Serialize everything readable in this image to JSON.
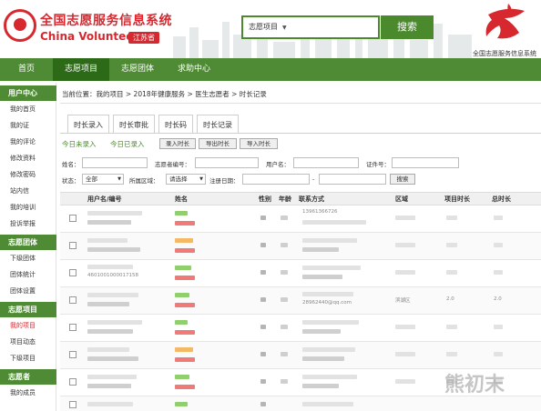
{
  "header": {
    "site_title": "全国志愿服务信息系统",
    "site_subtitle": "China Volunteer",
    "province": "江苏省",
    "search": {
      "selected": "志愿项目",
      "button": "搜索"
    },
    "brand_caption": "全国志愿服务信息系统"
  },
  "nav": {
    "items": [
      {
        "label": "首页"
      },
      {
        "label": "志愿项目"
      },
      {
        "label": "志愿团体"
      },
      {
        "label": "求助中心"
      }
    ]
  },
  "sidebar": {
    "sections": [
      {
        "title": "用户中心",
        "items": [
          "我的首页",
          "我的证",
          "我的评论",
          "修改资料",
          "修改密码",
          "站内信",
          "我的培训",
          "投诉举报"
        ]
      },
      {
        "title": "志愿团体",
        "items": [
          "下级团体",
          "团体统计",
          "团体设置"
        ]
      },
      {
        "title": "志愿项目",
        "items": [
          "我的项目",
          "项目动态",
          "下级项目"
        ]
      },
      {
        "title": "志愿者",
        "items": [
          "我的成员"
        ]
      }
    ]
  },
  "breadcrumb": "当前位置：我的项目 > 2018年健康服务 > 医生志愿者 > 时长记录",
  "tabs": [
    "时长录入",
    "时长审批",
    "时长码",
    "时长记录"
  ],
  "subtabs": [
    "今日未录入",
    "今日已录入"
  ],
  "actions": [
    "录入时长",
    "导出时长",
    "导入时长"
  ],
  "filters": {
    "name": "姓名：",
    "volunteer_no": "志愿者编号：",
    "username": "用户名：",
    "cert_no": "证件号：",
    "status": "状态：",
    "status_value": "全部",
    "region": "所属区域：",
    "region_value": "请选择",
    "reg_date": "注册日期：",
    "date_sep": "-",
    "search": "搜索"
  },
  "table": {
    "headers": [
      "用户名/编号",
      "姓名",
      "性别",
      "年龄",
      "联系方式",
      "区域",
      "项目时长",
      "总时长"
    ],
    "visible_fragments": {
      "r1_contact": "13961366726",
      "r3_id": "4601001000017158",
      "r4_contact": "28962440@qq.com",
      "r4_region": "滨湖区",
      "r4_hours": "2.0",
      "r4_total": "2.0"
    }
  },
  "watermark": "熊初末"
}
